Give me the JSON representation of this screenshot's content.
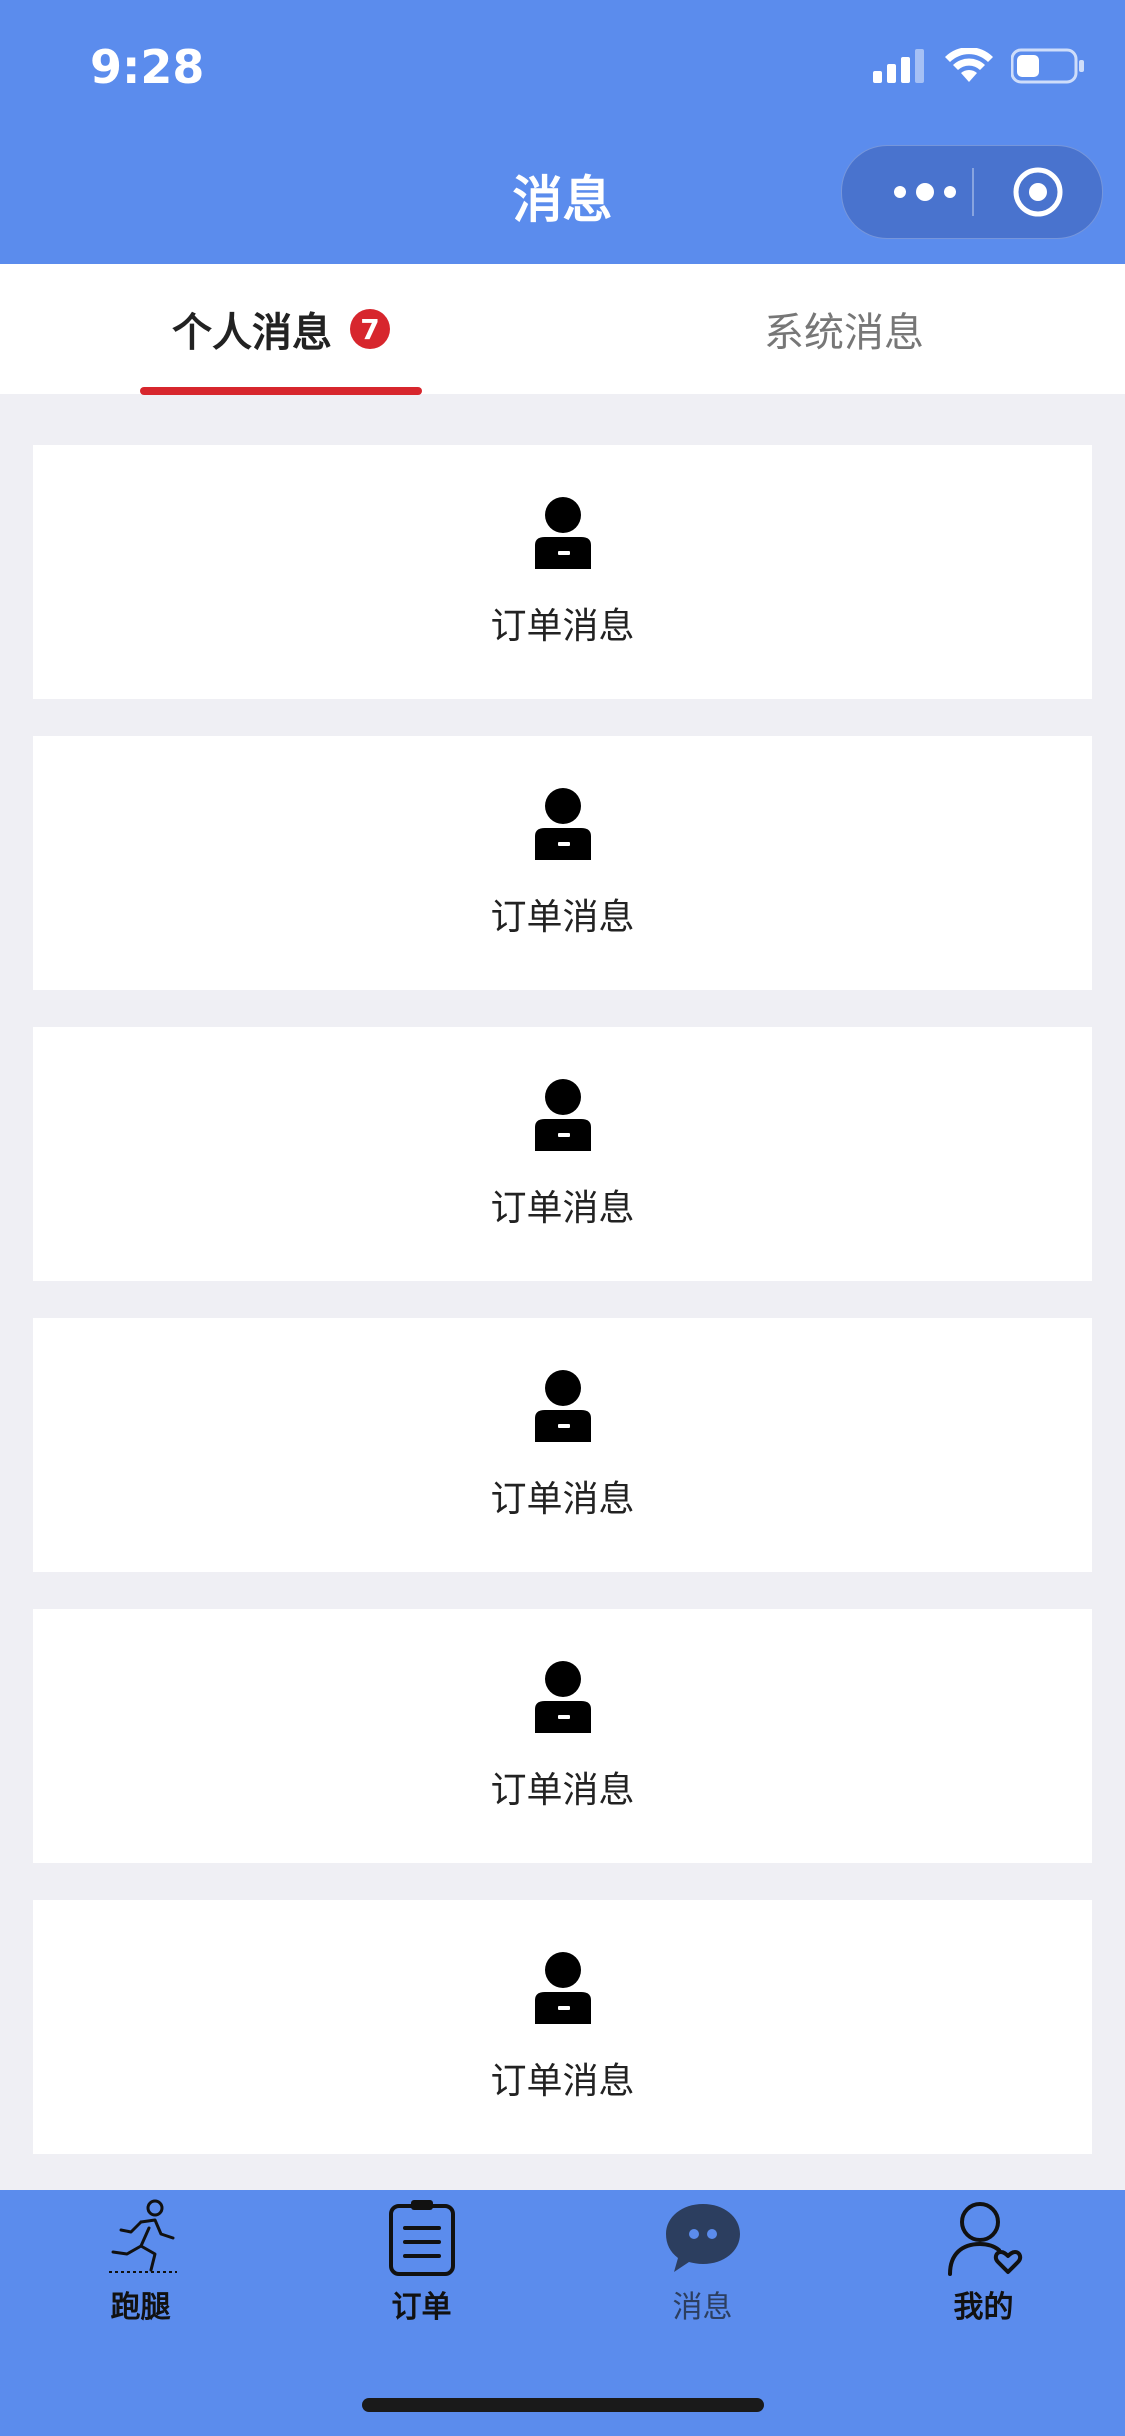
{
  "status_bar": {
    "time": "9:28"
  },
  "nav": {
    "title": "消息"
  },
  "tabs": [
    {
      "label": "个人消息",
      "badge": "7",
      "active": true
    },
    {
      "label": "系统消息",
      "active": false
    }
  ],
  "messages": [
    {
      "label": "订单消息",
      "icon": "user-icon"
    },
    {
      "label": "订单消息",
      "icon": "user-icon"
    },
    {
      "label": "订单消息",
      "icon": "user-icon"
    },
    {
      "label": "订单消息",
      "icon": "user-icon"
    },
    {
      "label": "订单消息",
      "icon": "user-icon"
    },
    {
      "label": "订单消息",
      "icon": "user-icon"
    }
  ],
  "tabbar": {
    "items": [
      {
        "label": "跑腿",
        "icon": "runner-icon"
      },
      {
        "label": "订单",
        "icon": "clipboard-icon"
      },
      {
        "label": "消息",
        "icon": "chat-bubble-icon",
        "active": true
      },
      {
        "label": "我的",
        "icon": "profile-heart-icon"
      }
    ]
  },
  "colors": {
    "brand": "#5b8ced",
    "badge": "#d7262d",
    "background": "#efeff4"
  }
}
